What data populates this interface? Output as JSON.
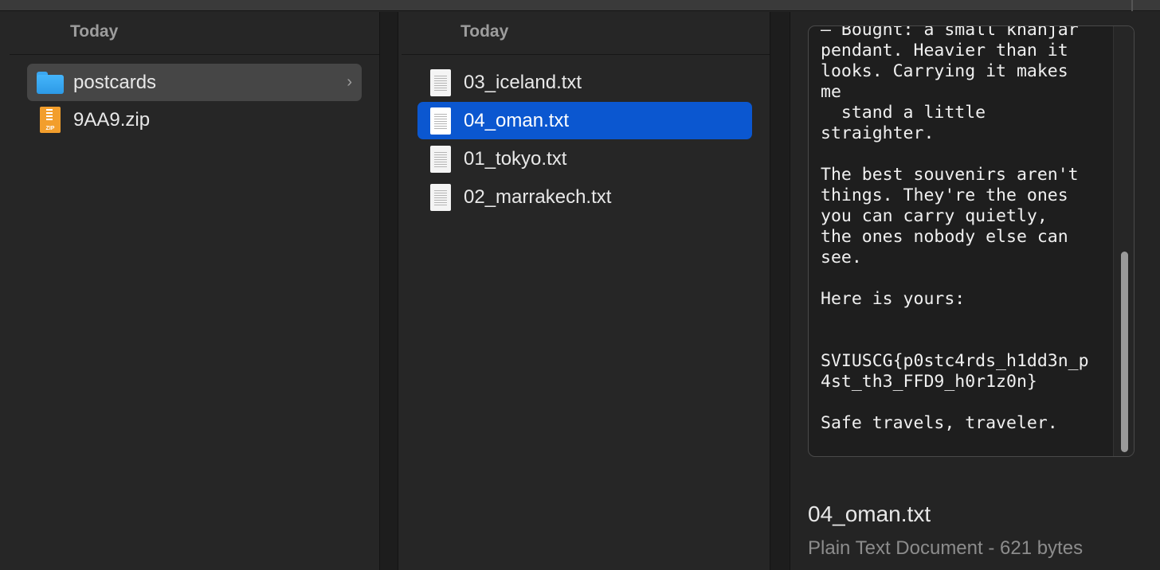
{
  "column1": {
    "header": "Today",
    "items": [
      {
        "label": "postcards",
        "icon": "folder-icon",
        "chevron": "›"
      },
      {
        "label": "9AA9.zip",
        "icon": "zip-icon",
        "icon_text": "ZIP"
      }
    ]
  },
  "column2": {
    "header": "Today",
    "items": [
      {
        "label": "03_iceland.txt",
        "icon": "text-file-icon"
      },
      {
        "label": "04_oman.txt",
        "icon": "text-file-icon"
      },
      {
        "label": "01_tokyo.txt",
        "icon": "text-file-icon"
      },
      {
        "label": "02_marrakech.txt",
        "icon": "text-file-icon"
      }
    ]
  },
  "preview": {
    "content": "– Bought: a small khanjar\npendant. Heavier than it\nlooks. Carrying it makes\nme\n  stand a little\nstraighter.\n\nThe best souvenirs aren't\nthings. They're the ones\nyou can carry quietly,\nthe ones nobody else can\nsee.\n\nHere is yours:\n\n\nSVIUSCG{p0stc4rds_h1dd3n_p\n4st_th3_FFD9_h0r1z0n}\n\nSafe travels, traveler.",
    "file_name": "04_oman.txt",
    "file_meta": "Plain Text Document - 621 bytes"
  },
  "colors": {
    "selection_blue": "#0b57d0",
    "selection_gray": "#464646",
    "folder_blue": "#3ba7f0",
    "zip_orange": "#f29e2c"
  }
}
